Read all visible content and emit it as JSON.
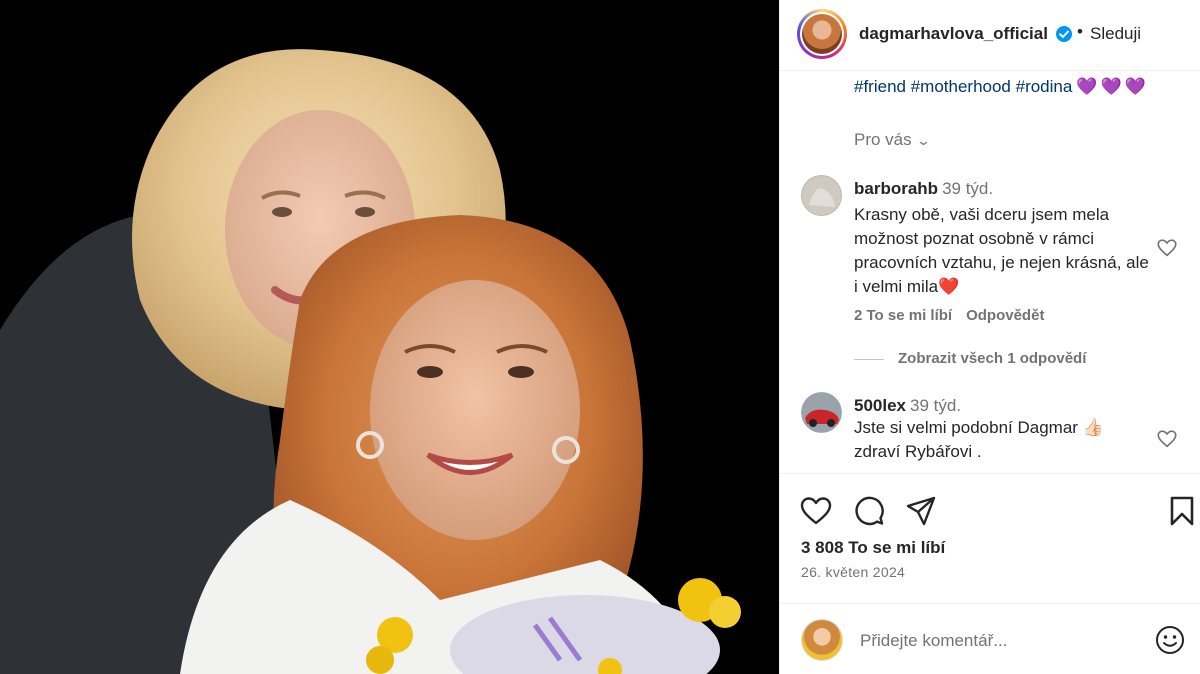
{
  "post": {
    "username": "dagmarhavlova_official",
    "follow_label": "Sleduji",
    "separator": "•",
    "hashtags": "#friend #motherhood #rodina",
    "hearts": "💜💜💜",
    "for_you_label": "Pro vás",
    "likes_text": "3 808 To se mi líbí",
    "date": "26. květen 2024",
    "add_comment_placeholder": "Přidejte komentář..."
  },
  "comments": [
    {
      "username": "barborahb",
      "time": "39 týd.",
      "text": "Krasny obě, vaši dceru jsem mela možnost poznat osobně v rámci pracovních vztahu, je nejen krásná, ale i velmi mila❤️",
      "likes": "2 To se mi líbí",
      "reply": "Odpovědět",
      "view_replies": "Zobrazit všech 1 odpovědí"
    },
    {
      "username": "500lex",
      "time": "39 týd.",
      "text": "Jste si velmi podobní Dagmar 👍🏻 zdraví Rybářovi ."
    }
  ],
  "icons": {
    "verified": "verified-badge-icon",
    "for_you_chevron": "chevron-down-icon",
    "comment_like": "heart-outline-icon",
    "like": "heart-outline-icon",
    "comment": "speech-bubble-icon",
    "share": "paper-plane-icon",
    "save": "bookmark-icon",
    "emoji": "smiley-icon"
  },
  "colors": {
    "link": "#00376b",
    "verified": "#0095f6",
    "secondary_text": "#737373",
    "heart_emoji": "#e0245e",
    "purple_heart": "#8e44c9"
  }
}
